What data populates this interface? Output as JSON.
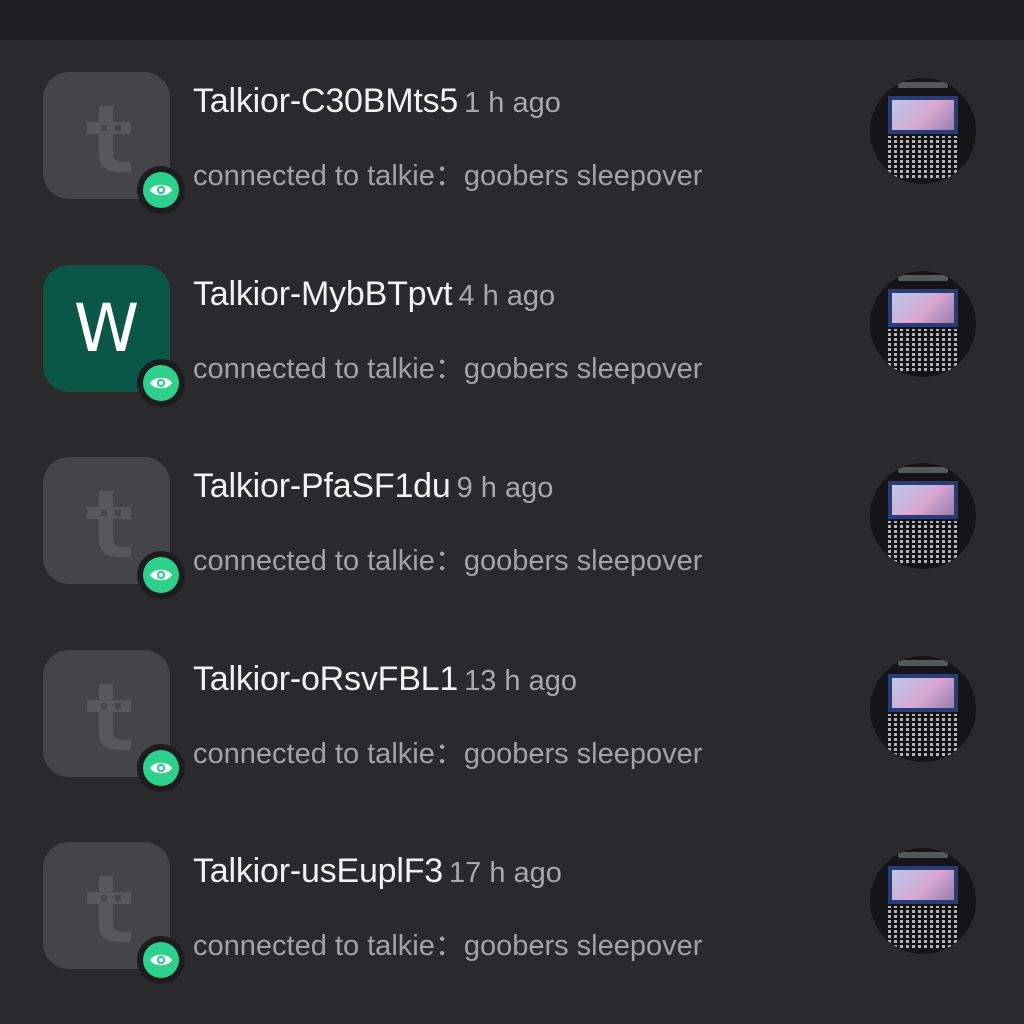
{
  "items": [
    {
      "avatar": "t-logo",
      "letter": "",
      "name": "Talkior-C30BMts5",
      "time": "1 h ago",
      "subtitle": "connected to talkie：goobers sleepover"
    },
    {
      "avatar": "letter",
      "letter": "W",
      "name": "Talkior-MybBTpvt",
      "time": "4 h ago",
      "subtitle": "connected to talkie：goobers sleepover"
    },
    {
      "avatar": "t-logo",
      "letter": "",
      "name": "Talkior-PfaSF1du",
      "time": "9 h ago",
      "subtitle": "connected to talkie：goobers sleepover"
    },
    {
      "avatar": "t-logo",
      "letter": "",
      "name": "Talkior-oRsvFBL1",
      "time": "13 h ago",
      "subtitle": "connected to talkie：goobers sleepover"
    },
    {
      "avatar": "t-logo",
      "letter": "",
      "name": "Talkior-usEuplF3",
      "time": "17 h ago",
      "subtitle": "connected to talkie：goobers sleepover"
    }
  ],
  "icons": {
    "badge": "eye-icon",
    "default_avatar": "talkie-t-logo-icon"
  },
  "colors": {
    "background": "#2a2a2d",
    "avatar_default": "#454548",
    "avatar_letter": "#0b5747",
    "badge": "#2ed18c",
    "name": "#f2f2f2",
    "secondary": "#a3a3a7"
  }
}
